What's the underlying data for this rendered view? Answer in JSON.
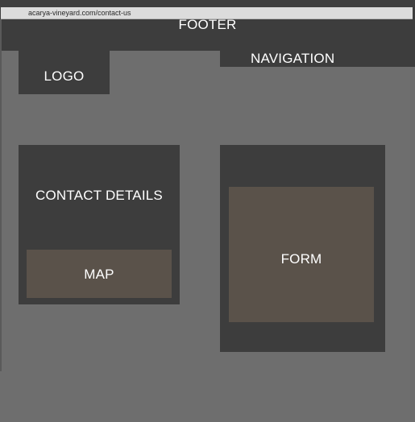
{
  "browser": {
    "url": "acarya-vineyard.com/contact-us"
  },
  "header": {
    "logo_label": "LOGO",
    "navigation_label": "NAVIGATION"
  },
  "main": {
    "contact_details_label": "CONTACT DETAILS",
    "map_label": "MAP",
    "form_label": "FORM"
  },
  "footer": {
    "label": "FOOTER"
  },
  "colors": {
    "page_background": "#6e6e6e",
    "block": "#3d3d3d",
    "placeholder_inner": "#5a524a",
    "address_bar": "#dcdcdc",
    "text": "#ffffff"
  }
}
